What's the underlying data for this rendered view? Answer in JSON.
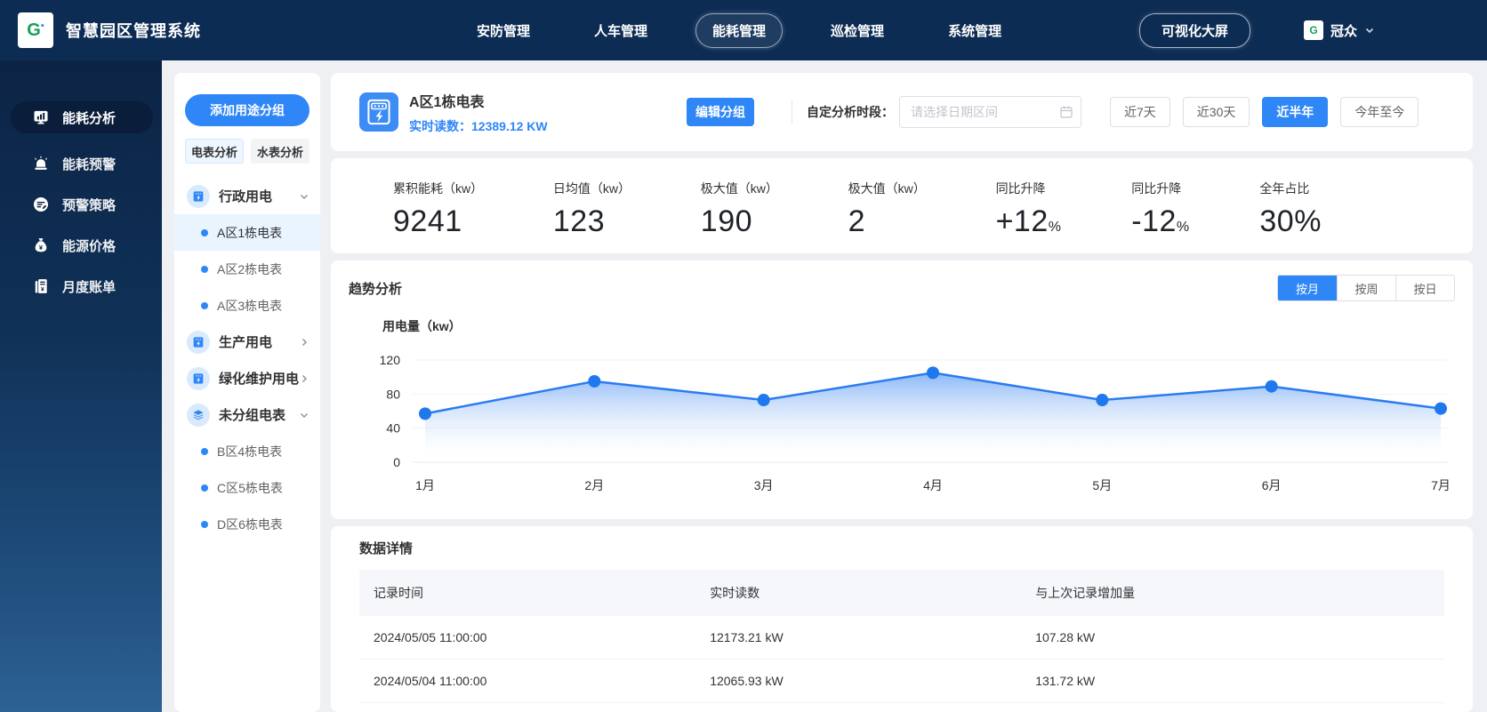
{
  "topbar": {
    "title": "智慧园区管理系统",
    "nav": [
      {
        "label": "安防管理",
        "active": false
      },
      {
        "label": "人车管理",
        "active": false
      },
      {
        "label": "能耗管理",
        "active": true
      },
      {
        "label": "巡检管理",
        "active": false
      },
      {
        "label": "系统管理",
        "active": false
      }
    ],
    "big_screen_button": "可视化大屏",
    "user": {
      "name": "冠众"
    }
  },
  "sidebar": {
    "items": [
      {
        "label": "能耗分析",
        "icon": "bar-chart-icon",
        "active": true
      },
      {
        "label": "能耗预警",
        "icon": "alarm-icon",
        "active": false
      },
      {
        "label": "预警策略",
        "icon": "strategy-icon",
        "active": false
      },
      {
        "label": "能源价格",
        "icon": "price-icon",
        "active": false
      },
      {
        "label": "月度账单",
        "icon": "bill-icon",
        "active": false
      }
    ]
  },
  "meter_panel": {
    "add_group_button": "添加用途分组",
    "tabs": [
      {
        "label": "电表分析",
        "active": true
      },
      {
        "label": "水表分析",
        "active": false
      }
    ],
    "groups": [
      {
        "label": "行政用电",
        "icon": "meter-icon",
        "expanded": true,
        "children": [
          {
            "label": "A区1栋电表",
            "selected": true
          },
          {
            "label": "A区2栋电表",
            "selected": false
          },
          {
            "label": "A区3栋电表",
            "selected": false
          }
        ]
      },
      {
        "label": "生产用电",
        "icon": "meter-icon",
        "expanded": false,
        "children": []
      },
      {
        "label": "绿化维护用电",
        "icon": "meter-icon",
        "expanded": false,
        "children": []
      },
      {
        "label": "未分组电表",
        "icon": "layers-icon",
        "expanded": true,
        "children": [
          {
            "label": "B区4栋电表",
            "selected": false
          },
          {
            "label": "C区5栋电表",
            "selected": false
          },
          {
            "label": "D区6栋电表",
            "selected": false
          }
        ]
      }
    ]
  },
  "header": {
    "meter_name": "A区1栋电表",
    "reading_label": "实时读数：",
    "reading_value": "12389.12 KW",
    "edit_group_button": "编辑分组",
    "period_label": "自定分析时段：",
    "date_placeholder": "请选择日期区间",
    "range_buttons": [
      {
        "label": "近7天",
        "active": false
      },
      {
        "label": "近30天",
        "active": false
      },
      {
        "label": "近半年",
        "active": true
      },
      {
        "label": "今年至今",
        "active": false
      }
    ]
  },
  "stats": [
    {
      "label": "累积能耗（kw）",
      "value": "9241",
      "suffix": ""
    },
    {
      "label": "日均值（kw）",
      "value": "123",
      "suffix": ""
    },
    {
      "label": "极大值（kw）",
      "value": "190",
      "suffix": ""
    },
    {
      "label": "极大值（kw）",
      "value": "2",
      "suffix": ""
    },
    {
      "label": "同比升降",
      "value": "+12",
      "suffix": "%"
    },
    {
      "label": "同比升降",
      "value": "-12",
      "suffix": "%"
    },
    {
      "label": "全年占比",
      "value": "30%",
      "suffix": ""
    }
  ],
  "trend": {
    "title": "趋势分析",
    "tabs": [
      {
        "label": "按月",
        "active": true
      },
      {
        "label": "按周",
        "active": false
      },
      {
        "label": "按日",
        "active": false
      }
    ]
  },
  "chart_data": {
    "type": "area",
    "title": "趋势分析",
    "ylabel": "用电量（kw）",
    "categories": [
      "1月",
      "2月",
      "3月",
      "4月",
      "5月",
      "6月",
      "7月"
    ],
    "values": [
      57,
      95,
      73,
      105,
      73,
      89,
      63
    ],
    "ylim": [
      0,
      120
    ],
    "yticks": [
      0,
      40,
      80,
      120
    ],
    "grid": true,
    "legend": false,
    "line_color": "#2b7cf0",
    "point_color": "#1f78ed"
  },
  "table": {
    "title": "数据详情",
    "columns": [
      "记录时间",
      "实时读数",
      "与上次记录增加量"
    ],
    "rows": [
      [
        "2024/05/05 11:00:00",
        "12173.21 kW",
        "107.28 kW"
      ],
      [
        "2024/05/04 11:00:00",
        "12065.93 kW",
        "131.72 kW"
      ]
    ]
  },
  "colors": {
    "primary": "#2f86f6",
    "navbar_navy": "#0d2c54",
    "selected_item_bg": "#e9f4fe",
    "page_bg": "#eef0f3"
  }
}
